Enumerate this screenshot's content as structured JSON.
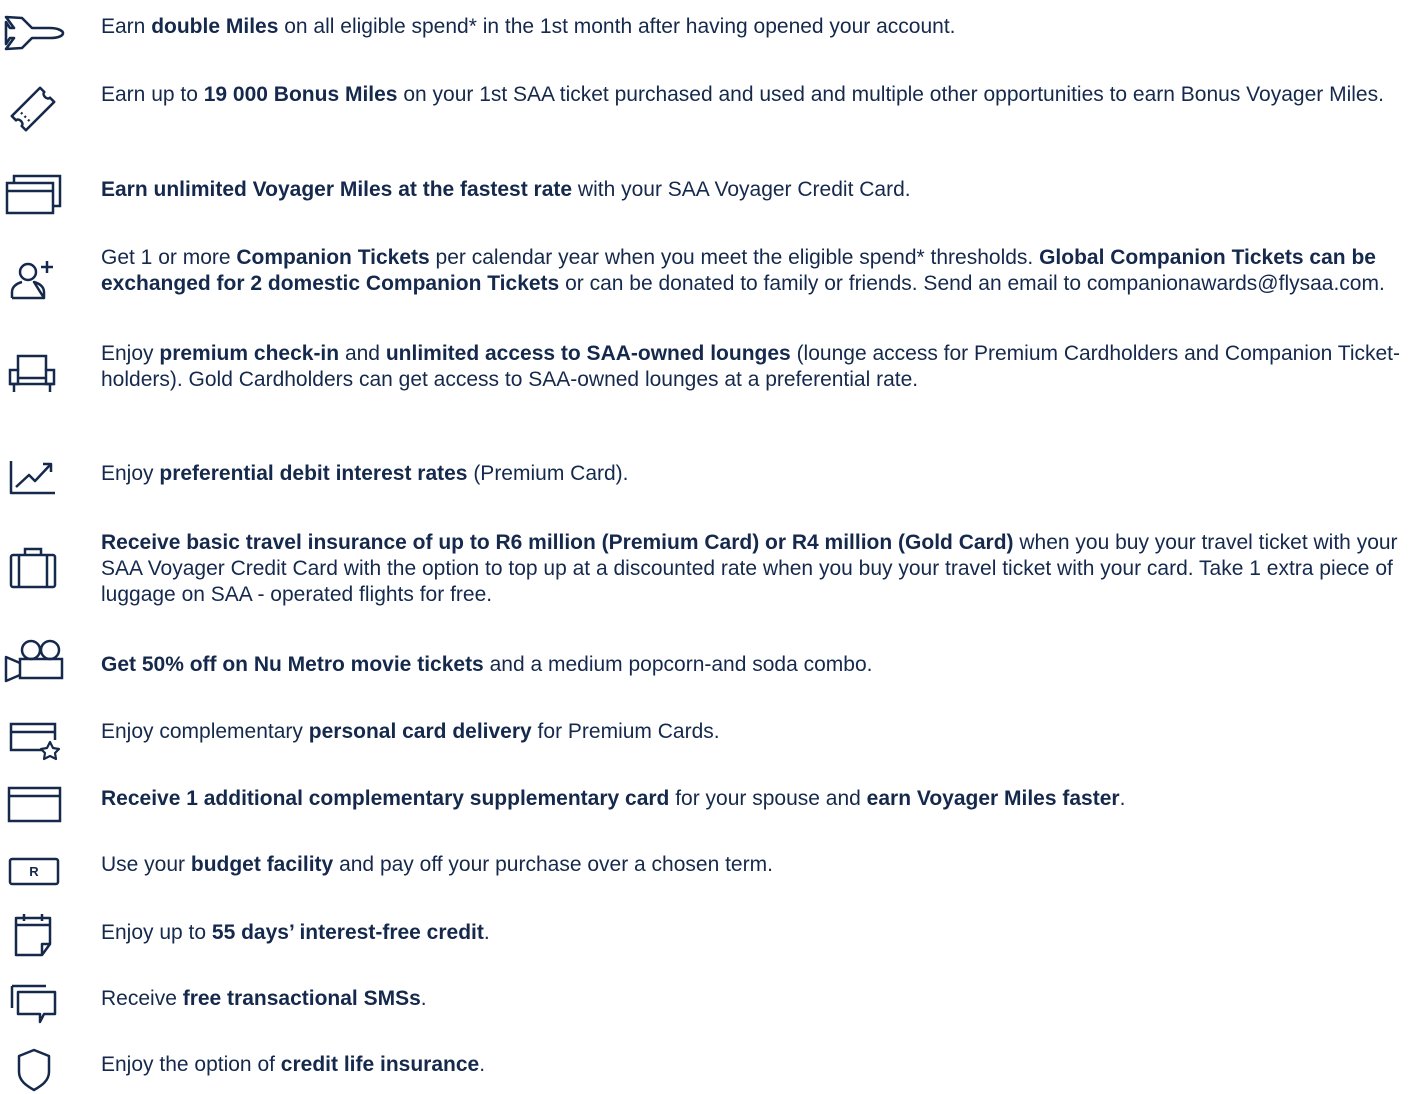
{
  "benefits": [
    {
      "id": "double-miles",
      "icon": "airplane-icon",
      "segments": [
        {
          "t": "Earn ",
          "b": false
        },
        {
          "t": "double Miles",
          "b": true
        },
        {
          "t": " on all eligible spend* in the 1st month after having opened your account.",
          "b": false
        }
      ]
    },
    {
      "id": "bonus-miles",
      "icon": "ticket-icon",
      "segments": [
        {
          "t": "Earn up to ",
          "b": false
        },
        {
          "t": "19 000 Bonus Miles",
          "b": true
        },
        {
          "t": " on your 1st SAA ticket purchased and used and multiple other opportunities to earn Bonus Voyager Miles.",
          "b": false
        }
      ]
    },
    {
      "id": "unlimited-miles",
      "icon": "cards-icon",
      "segments": [
        {
          "t": "Earn unlimited Voyager Miles at the fastest rate",
          "b": true
        },
        {
          "t": " with your SAA Voyager Credit Card.",
          "b": false
        }
      ]
    },
    {
      "id": "companion-tickets",
      "icon": "add-user-icon",
      "segments": [
        {
          "t": "Get 1 or more ",
          "b": false
        },
        {
          "t": "Companion Tickets",
          "b": true
        },
        {
          "t": " per calendar year when you meet the eligible spend* thresholds. ",
          "b": false
        },
        {
          "t": "Global Companion Tickets can be exchanged for 2 domestic Companion Tickets",
          "b": true
        },
        {
          "t": " or can be donated to family or friends. Send an email to companionawards@flysaa.com.",
          "b": false
        }
      ]
    },
    {
      "id": "lounges",
      "icon": "armchair-icon",
      "segments": [
        {
          "t": "Enjoy ",
          "b": false
        },
        {
          "t": "premium check-in",
          "b": true
        },
        {
          "t": " and ",
          "b": false
        },
        {
          "t": "unlimited access to SAA-owned lounges",
          "b": true
        },
        {
          "t": " (lounge access for Premium Cardholders and Companion Ticket-holders). Gold Cardholders can get access to SAA-owned lounges at a preferential rate.",
          "b": false
        }
      ]
    },
    {
      "id": "debit-interest",
      "icon": "growth-chart-icon",
      "segments": [
        {
          "t": "Enjoy ",
          "b": false
        },
        {
          "t": "preferential debit interest rates",
          "b": true
        },
        {
          "t": " (Premium Card).",
          "b": false
        }
      ]
    },
    {
      "id": "travel-insurance",
      "icon": "luggage-icon",
      "segments": [
        {
          "t": "Receive basic travel insurance of up to R6 million (Premium Card) or R4 million (Gold Card)",
          "b": true
        },
        {
          "t": " when you buy your travel ticket with your SAA Voyager Credit Card with the option to top up at a discounted rate when you buy your travel ticket with your card. Take 1 extra piece of luggage on SAA - operated flights for free.",
          "b": false
        }
      ]
    },
    {
      "id": "movies",
      "icon": "movie-camera-icon",
      "segments": [
        {
          "t": "Get 50% off on Nu Metro movie tickets",
          "b": true
        },
        {
          "t": " and a medium popcorn-and soda combo.",
          "b": false
        }
      ]
    },
    {
      "id": "card-delivery",
      "icon": "card-star-icon",
      "segments": [
        {
          "t": "Enjoy complementary ",
          "b": false
        },
        {
          "t": "personal card delivery",
          "b": true
        },
        {
          "t": " for Premium Cards.",
          "b": false
        }
      ]
    },
    {
      "id": "supplementary-card",
      "icon": "card-icon",
      "segments": [
        {
          "t": "Receive 1 additional complementary supplementary card",
          "b": true
        },
        {
          "t": " for your spouse and ",
          "b": false
        },
        {
          "t": "earn Voyager Miles faster",
          "b": true
        },
        {
          "t": ".",
          "b": false
        }
      ]
    },
    {
      "id": "budget-facility",
      "icon": "rand-note-icon",
      "icon_text": "R",
      "segments": [
        {
          "t": "Use your ",
          "b": false
        },
        {
          "t": "budget facility",
          "b": true
        },
        {
          "t": " and pay off your purchase over a chosen term.",
          "b": false
        }
      ]
    },
    {
      "id": "interest-free",
      "icon": "calendar-icon",
      "segments": [
        {
          "t": "Enjoy up to ",
          "b": false
        },
        {
          "t": "55 days’ interest-free credit",
          "b": true
        },
        {
          "t": ".",
          "b": false
        }
      ]
    },
    {
      "id": "sms",
      "icon": "chat-icon",
      "segments": [
        {
          "t": "Receive ",
          "b": false
        },
        {
          "t": "free transactional SMSs",
          "b": true
        },
        {
          "t": ".",
          "b": false
        }
      ]
    },
    {
      "id": "credit-life",
      "icon": "shield-icon",
      "segments": [
        {
          "t": "Enjoy the option of ",
          "b": false
        },
        {
          "t": "credit life insurance",
          "b": true
        },
        {
          "t": ".",
          "b": false
        }
      ]
    }
  ]
}
